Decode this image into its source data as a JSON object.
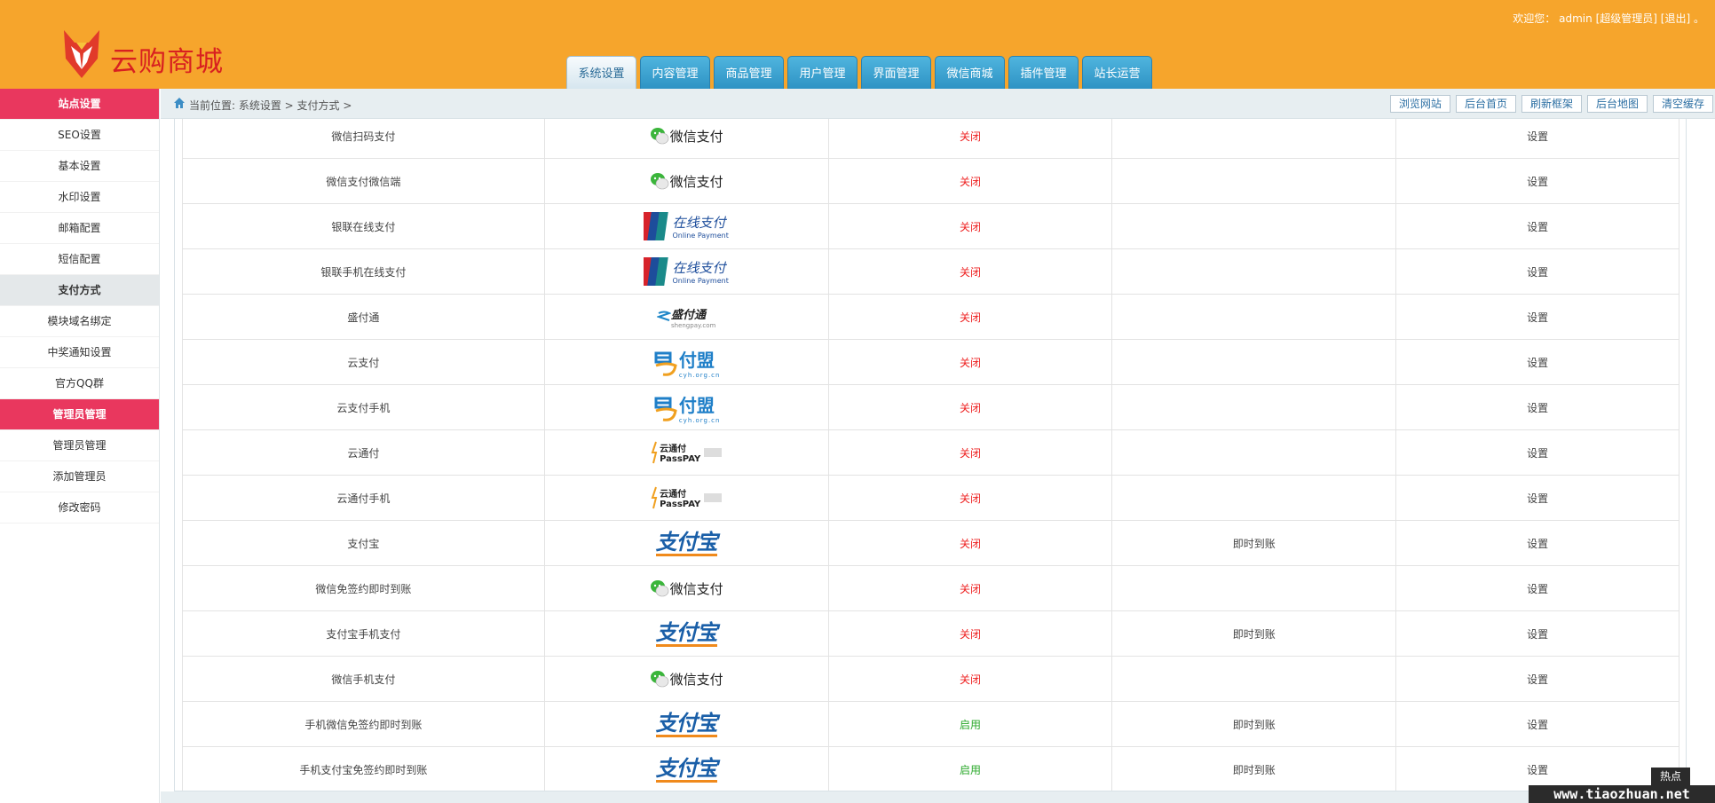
{
  "header": {
    "brand": "云购商城",
    "welcome_prefix": "欢迎您：",
    "user": "admin",
    "role": "[超级管理员]",
    "logout": "[退出]",
    "accent": "#f6a52c"
  },
  "tabs": [
    {
      "label": "系统设置",
      "active": true
    },
    {
      "label": "内容管理"
    },
    {
      "label": "商品管理"
    },
    {
      "label": "用户管理"
    },
    {
      "label": "界面管理"
    },
    {
      "label": "微信商城"
    },
    {
      "label": "插件管理"
    },
    {
      "label": "站长运营"
    }
  ],
  "sidebar": {
    "items": [
      {
        "label": "站点设置",
        "type": "group"
      },
      {
        "label": "SEO设置"
      },
      {
        "label": "基本设置"
      },
      {
        "label": "水印设置"
      },
      {
        "label": "邮箱配置"
      },
      {
        "label": "短信配置"
      },
      {
        "label": "支付方式",
        "type": "current"
      },
      {
        "label": "模块域名绑定"
      },
      {
        "label": "中奖通知设置"
      },
      {
        "label": "官方QQ群"
      },
      {
        "label": "管理员管理",
        "type": "group"
      },
      {
        "label": "管理员管理"
      },
      {
        "label": "添加管理员"
      },
      {
        "label": "修改密码"
      }
    ]
  },
  "breadcrumb": {
    "text": "当前位置: 系统设置 > 支付方式 >"
  },
  "toolbar": [
    "浏览网站",
    "后台首页",
    "刷新框架",
    "后台地图",
    "清空缓存"
  ],
  "payment_table": {
    "action_label": "设置",
    "rows": [
      {
        "name": "微信扫码支付",
        "logo": "wechat-pay-logo",
        "logo_text": "微信支付",
        "status": "关闭",
        "note": ""
      },
      {
        "name": "微信支付微信端",
        "logo": "wechat-pay-logo",
        "logo_text": "微信支付",
        "status": "关闭",
        "note": ""
      },
      {
        "name": "银联在线支付",
        "logo": "unionpay-logo",
        "logo_text": "在线支付",
        "logo_sub": "Online Payment",
        "status": "关闭",
        "note": ""
      },
      {
        "name": "银联手机在线支付",
        "logo": "unionpay-logo",
        "logo_text": "在线支付",
        "logo_sub": "Online Payment",
        "status": "关闭",
        "note": ""
      },
      {
        "name": "盛付通",
        "logo": "shengpay-logo",
        "logo_text": "盛付通",
        "logo_sub": "shengpay.com",
        "status": "关闭",
        "note": ""
      },
      {
        "name": "云支付",
        "logo": "yifumeng-logo",
        "logo_text": "付盟",
        "logo_sub": "cyh.org.cn",
        "status": "关闭",
        "note": ""
      },
      {
        "name": "云支付手机",
        "logo": "yifumeng-logo",
        "logo_text": "付盟",
        "logo_sub": "cyh.org.cn",
        "status": "关闭",
        "note": ""
      },
      {
        "name": "云通付",
        "logo": "passpay-logo",
        "logo_text": "云通付",
        "logo_sub": "PassPAY",
        "status": "关闭",
        "note": ""
      },
      {
        "name": "云通付手机",
        "logo": "passpay-logo",
        "logo_text": "云通付",
        "logo_sub": "PassPAY",
        "status": "关闭",
        "note": ""
      },
      {
        "name": "支付宝",
        "logo": "alipay-logo",
        "logo_text": "支付宝",
        "status": "关闭",
        "note": "即时到账"
      },
      {
        "name": "微信免签约即时到账",
        "logo": "wechat-pay-logo",
        "logo_text": "微信支付",
        "status": "关闭",
        "note": ""
      },
      {
        "name": "支付宝手机支付",
        "logo": "alipay-logo",
        "logo_text": "支付宝",
        "status": "关闭",
        "note": "即时到账"
      },
      {
        "name": "微信手机支付",
        "logo": "wechat-pay-logo",
        "logo_text": "微信支付",
        "status": "关闭",
        "note": ""
      },
      {
        "name": "手机微信免签约即时到账",
        "logo": "alipay-logo",
        "logo_text": "支付宝",
        "status": "启用",
        "note": "即时到账"
      },
      {
        "name": "手机支付宝免签约即时到账",
        "logo": "alipay-logo",
        "logo_text": "支付宝",
        "status": "启用",
        "note": "即时到账"
      }
    ]
  },
  "watermark": {
    "top": "热点",
    "bottom": "www.tiaozhuan.net"
  },
  "colors": {
    "status_off": "#e22222",
    "status_on": "#2aa82a",
    "sidebar_group": "#e9375e"
  }
}
